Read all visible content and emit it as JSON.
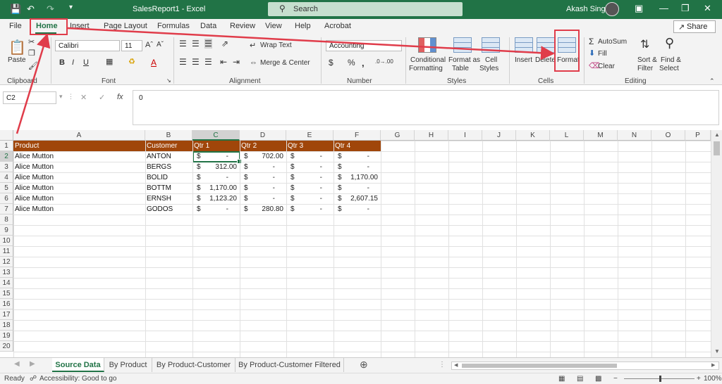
{
  "titlebar": {
    "title": "SalesReport1  -  Excel",
    "search_placeholder": "Search",
    "user": "Akash Singh",
    "save_icon": "save-icon",
    "undo_icon": "undo-icon",
    "redo_icon": "redo-icon"
  },
  "tabs": {
    "file": "File",
    "home": "Home",
    "insert": "Insert",
    "page_layout": "Page Layout",
    "formulas": "Formulas",
    "data": "Data",
    "review": "Review",
    "view": "View",
    "help": "Help",
    "acrobat": "Acrobat",
    "share": "Share"
  },
  "ribbon": {
    "clipboard": {
      "paste": "Paste",
      "label": "Clipboard"
    },
    "font": {
      "name": "Calibri",
      "size": "11",
      "label": "Font"
    },
    "alignment": {
      "wrap": "Wrap Text",
      "merge": "Merge & Center",
      "label": "Alignment"
    },
    "number": {
      "format": "Accounting",
      "label": "Number"
    },
    "styles": {
      "conditional_1": "Conditional",
      "conditional_2": "Formatting",
      "format_as_1": "Format as",
      "format_as_2": "Table",
      "cell_styles_1": "Cell",
      "cell_styles_2": "Styles",
      "label": "Styles"
    },
    "cells": {
      "insert": "Insert",
      "delete": "Delete",
      "format": "Format",
      "label": "Cells"
    },
    "editing": {
      "autosum": "AutoSum",
      "fill": "Fill",
      "clear": "Clear",
      "sort_1": "Sort &",
      "sort_2": "Filter",
      "find_1": "Find &",
      "find_2": "Select",
      "label": "Editing"
    }
  },
  "formula_bar": {
    "name_box": "C2",
    "value": "0",
    "fx": "fx"
  },
  "columns": [
    "A",
    "B",
    "C",
    "D",
    "E",
    "F",
    "G",
    "H",
    "I",
    "J",
    "K",
    "L",
    "M",
    "N",
    "O",
    "P"
  ],
  "selected_column": "C",
  "selected_row": 2,
  "rows": [
    1,
    2,
    3,
    4,
    5,
    6,
    7,
    8,
    9,
    10,
    11,
    12,
    13,
    14,
    15,
    16,
    17,
    18,
    19,
    20
  ],
  "table": {
    "headers": [
      "Product",
      "Customer",
      "Qtr 1",
      "Qtr 2",
      "Qtr 3",
      "Qtr 4"
    ],
    "currency": "$",
    "data": [
      [
        "Alice Mutton",
        "ANTON",
        "-",
        "702.00",
        "-",
        "-"
      ],
      [
        "Alice Mutton",
        "BERGS",
        "312.00",
        "-",
        "-",
        "-"
      ],
      [
        "Alice Mutton",
        "BOLID",
        "-",
        "-",
        "-",
        "1,170.00"
      ],
      [
        "Alice Mutton",
        "BOTTM",
        "1,170.00",
        "-",
        "-",
        "-"
      ],
      [
        "Alice Mutton",
        "ERNSH",
        "1,123.20",
        "-",
        "-",
        "2,607.15"
      ],
      [
        "Alice Mutton",
        "GODOS",
        "-",
        "280.80",
        "-",
        "-"
      ]
    ]
  },
  "sheets": {
    "tabs": [
      "Source Data",
      "By Product",
      "By Product-Customer",
      "By Product-Customer Filtered"
    ],
    "active": 0
  },
  "status": {
    "ready": "Ready",
    "accessibility": "Accessibility: Good to go",
    "zoom": "100%"
  },
  "colors": {
    "accent": "#217346",
    "header_fill": "#a0460a",
    "annotation": "#e03c4a"
  }
}
